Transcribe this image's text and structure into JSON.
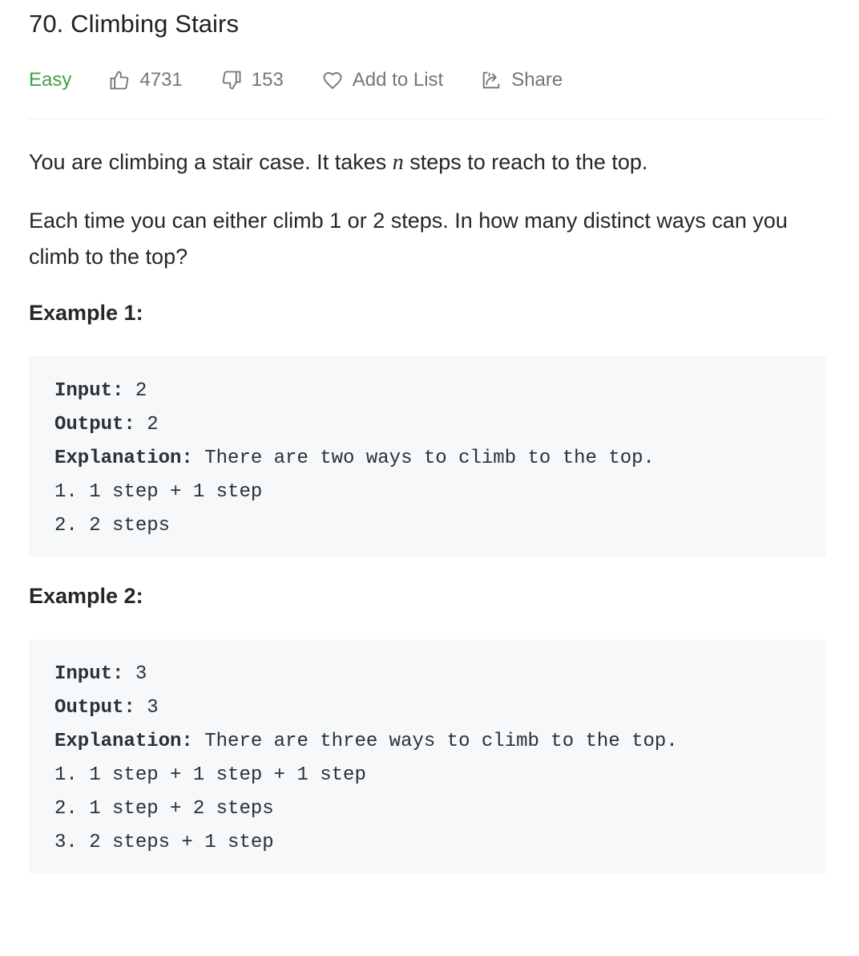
{
  "problem": {
    "title": "70. Climbing Stairs",
    "difficulty": "Easy",
    "likes": "4731",
    "dislikes": "153",
    "add_to_list": "Add to List",
    "share": "Share"
  },
  "description": {
    "p1_before": "You are climbing a stair case. It takes ",
    "p1_var": "n",
    "p1_after": " steps to reach to the top.",
    "p2": "Each time you can either climb 1 or 2 steps. In how many distinct ways can you climb to the top?"
  },
  "examples": [
    {
      "heading": "Example 1:",
      "input_label": "Input:",
      "input_value": " 2",
      "output_label": "Output:",
      "output_value": " 2",
      "explanation_label": "Explanation:",
      "explanation_value": " There are two ways to climb to the top.",
      "lines": [
        "1. 1 step + 1 step",
        "2. 2 steps"
      ]
    },
    {
      "heading": "Example 2:",
      "input_label": "Input:",
      "input_value": " 3",
      "output_label": "Output:",
      "output_value": " 3",
      "explanation_label": "Explanation:",
      "explanation_value": " There are three ways to climb to the top.",
      "lines": [
        "1. 1 step + 1 step + 1 step",
        "2. 1 step + 2 steps",
        "3. 2 steps + 1 step"
      ]
    }
  ],
  "colors": {
    "difficulty_easy": "#43a047",
    "meta_text": "#757575",
    "code_bg": "#f7f8fa"
  },
  "icons": [
    "thumbs-up-icon",
    "thumbs-down-icon",
    "heart-icon",
    "share-icon"
  ]
}
